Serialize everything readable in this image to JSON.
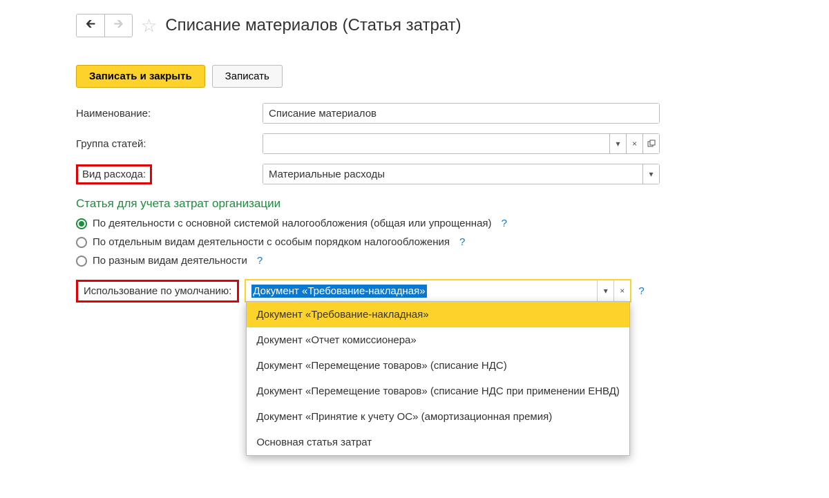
{
  "header": {
    "title": "Списание материалов (Статья затрат)"
  },
  "toolbar": {
    "save_close": "Записать и закрыть",
    "save": "Записать"
  },
  "form": {
    "name_label": "Наименование:",
    "name_value": "Списание материалов",
    "group_label": "Группа статей:",
    "group_value": "",
    "expense_type_label": "Вид расхода:",
    "expense_type_value": "Материальные расходы"
  },
  "section": {
    "title": "Статья для учета затрат организации",
    "radios": [
      {
        "label": "По деятельности с основной системой налогообложения (общая или упрощенная)",
        "checked": true
      },
      {
        "label": "По отдельным видам деятельности с особым порядком налогообложения",
        "checked": false
      },
      {
        "label": "По разным видам деятельности",
        "checked": false
      }
    ]
  },
  "default_usage": {
    "label": "Использование по умолчанию:",
    "value": "Документ «Требование-накладная»",
    "options": [
      "Документ «Требование-накладная»",
      "Документ «Отчет комиссионера»",
      "Документ «Перемещение товаров» (списание НДС)",
      "Документ «Перемещение товаров» (списание НДС при применении ЕНВД)",
      "Документ «Принятие к учету ОС» (амортизационная премия)",
      "Основная статья затрат"
    ]
  },
  "help": "?"
}
